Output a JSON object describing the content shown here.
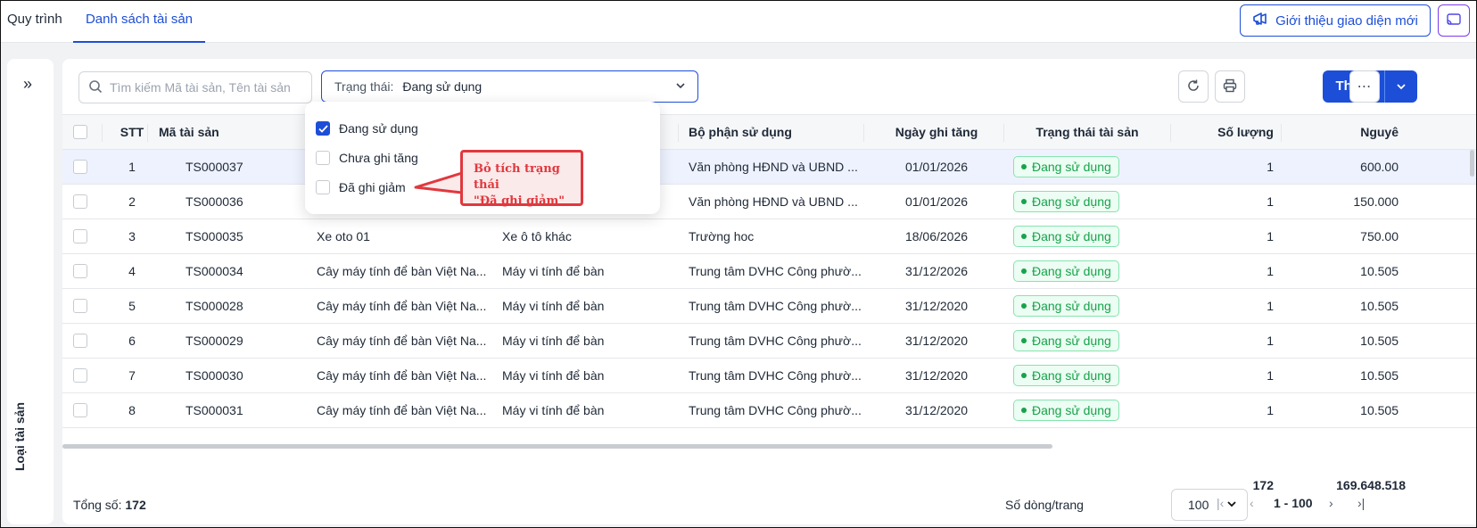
{
  "tabs": [
    {
      "label": "Quy trình",
      "active": false
    },
    {
      "label": "Danh sách tài sản",
      "active": true
    }
  ],
  "header": {
    "intro_button": "Giới thiệu giao diện mới"
  },
  "sidebar": {
    "vertical_label": "Loại tài sản"
  },
  "toolbar": {
    "search_placeholder": "Tìm kiếm Mã tài sản, Tên tài sản",
    "status_label": "Trạng thái:",
    "status_value": "Đang sử dụng",
    "add_label": "Thêm"
  },
  "status_options": [
    {
      "label": "Đang sử dụng",
      "checked": true
    },
    {
      "label": "Chưa ghi tăng",
      "checked": false
    },
    {
      "label": "Đã ghi giảm",
      "checked": false
    }
  ],
  "callout": {
    "line1": "Bỏ tích trạng thái",
    "line2": "\"Đã ghi giảm\""
  },
  "table": {
    "columns": [
      "STT",
      "Mã tài sản",
      "Bộ phận sử dụng",
      "Ngày ghi tăng",
      "Trạng thái tài sản",
      "Số lượng",
      "Nguyê"
    ],
    "rows": [
      {
        "stt": "1",
        "code": "TS000037",
        "name": "",
        "type": "",
        "dept": "Văn phòng HĐND và UBND ...",
        "date": "01/01/2026",
        "status": "Đang sử dụng",
        "qty": "1",
        "value": "600.00"
      },
      {
        "stt": "2",
        "code": "TS000036",
        "name": "",
        "type": "",
        "dept": "Văn phòng HĐND và UBND ...",
        "date": "01/01/2026",
        "status": "Đang sử dụng",
        "qty": "1",
        "value": "150.000"
      },
      {
        "stt": "3",
        "code": "TS000035",
        "name": "Xe oto 01",
        "type": "Xe ô tô khác",
        "dept": "Trường hoc",
        "date": "18/06/2026",
        "status": "Đang sử dụng",
        "qty": "1",
        "value": "750.00"
      },
      {
        "stt": "4",
        "code": "TS000034",
        "name": "Cây máy tính để bàn Việt Na...",
        "type": "Máy vi tính để bàn",
        "dept": "Trung tâm DVHC Công phườ...",
        "date": "31/12/2026",
        "status": "Đang sử dụng",
        "qty": "1",
        "value": "10.505"
      },
      {
        "stt": "5",
        "code": "TS000028",
        "name": "Cây máy tính để bàn Việt Na...",
        "type": "Máy vi tính để bàn",
        "dept": "Trung tâm DVHC Công phườ...",
        "date": "31/12/2020",
        "status": "Đang sử dụng",
        "qty": "1",
        "value": "10.505"
      },
      {
        "stt": "6",
        "code": "TS000029",
        "name": "Cây máy tính để bàn Việt Na...",
        "type": "Máy vi tính để bàn",
        "dept": "Trung tâm DVHC Công phườ...",
        "date": "31/12/2020",
        "status": "Đang sử dụng",
        "qty": "1",
        "value": "10.505"
      },
      {
        "stt": "7",
        "code": "TS000030",
        "name": "Cây máy tính để bàn Việt Na...",
        "type": "Máy vi tính để bàn",
        "dept": "Trung tâm DVHC Công phườ...",
        "date": "31/12/2020",
        "status": "Đang sử dụng",
        "qty": "1",
        "value": "10.505"
      },
      {
        "stt": "8",
        "code": "TS000031",
        "name": "Cây máy tính để bàn Việt Na...",
        "type": "Máy vi tính để bàn",
        "dept": "Trung tâm DVHC Công phườ...",
        "date": "31/12/2020",
        "status": "Đang sử dụng",
        "qty": "1",
        "value": "10.505"
      }
    ],
    "total_qty": "172",
    "total_value": "169.648.518"
  },
  "footer": {
    "total_label": "Tổng số:",
    "total_value": "172",
    "rows_per_page_label": "Số dòng/trang",
    "rows_per_page_value": "100",
    "range": "1 - 100"
  },
  "colors": {
    "primary": "#1d4ed8",
    "success": "#16a34a",
    "callout": "#e0383e"
  }
}
